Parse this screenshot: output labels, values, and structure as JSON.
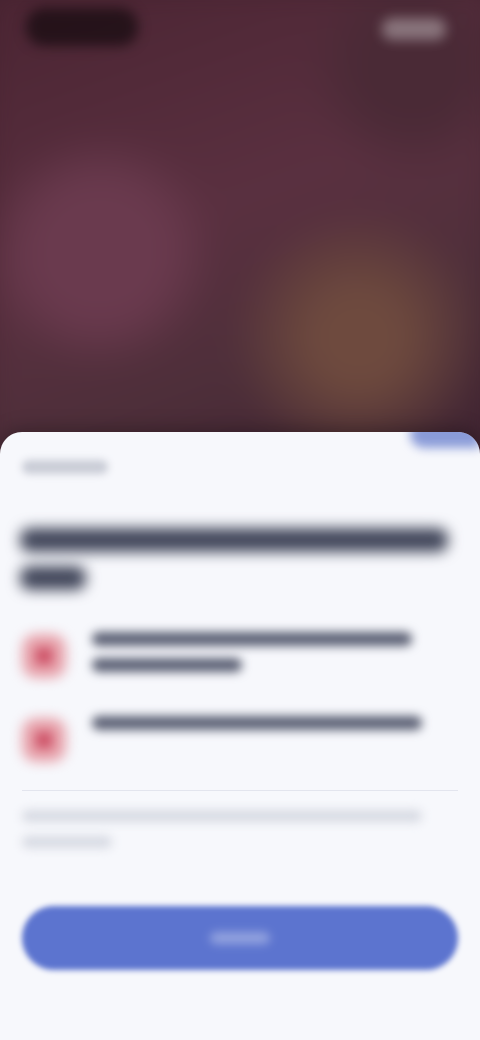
{
  "status_bar": {
    "left_label": "",
    "right_label": ""
  },
  "sheet": {
    "eyebrow": "",
    "title": "",
    "items": [
      {
        "icon": "warning-icon",
        "text": ""
      },
      {
        "icon": "warning-icon",
        "text": ""
      }
    ],
    "note": "",
    "cta_label": ""
  },
  "colors": {
    "backdrop": "#4e2a38",
    "sheet_background": "#f7f8fc",
    "accent": "#5c74cf",
    "icon_tint": "#c9425a"
  }
}
